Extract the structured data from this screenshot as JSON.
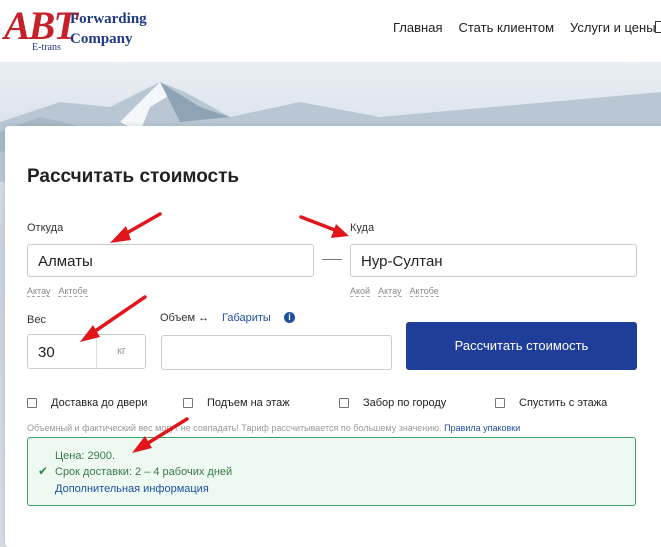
{
  "logo": {
    "abt": "ABT",
    "sub": "E-trans",
    "line1": "Forwarding",
    "line2": "Company"
  },
  "nav": {
    "items": [
      "Главная",
      "Стать клиентом",
      "Услуги и цены"
    ]
  },
  "form": {
    "title": "Рассчитать стоимость",
    "from": {
      "label": "Откуда",
      "value": "Алматы",
      "hints": [
        "Актау",
        "Актобе"
      ]
    },
    "to": {
      "label": "Куда",
      "value": "Нур-Султан",
      "hints": [
        "Акой",
        "Актау",
        "Актобе"
      ]
    },
    "weight": {
      "label": "Вес",
      "value": "30",
      "unit": "кг"
    },
    "volume": {
      "label": "Объем",
      "arrow": "↔",
      "dims_label": "Габариты",
      "info": "i",
      "value": ""
    },
    "calc_button": "Рассчитать стоимость",
    "options": [
      "Доставка до двери",
      "Подъем на этаж",
      "Забор по городу",
      "Спустить с этажа"
    ],
    "note": "Объемный и фактический вес могут не совпадать! Тариф рассчитывается по большему значению.",
    "note_link": "Правила упаковки"
  },
  "result": {
    "price": "Цена: 2900.",
    "term": "Срок доставки: 2 – 4 рабочих дней",
    "more": "Дополнительная информация",
    "check": "✔"
  },
  "colors": {
    "brand_red": "#c8202a",
    "brand_blue": "#1f3a80",
    "button": "#1f3e9a",
    "success": "#3fa365",
    "arrow": "#e0161b"
  }
}
